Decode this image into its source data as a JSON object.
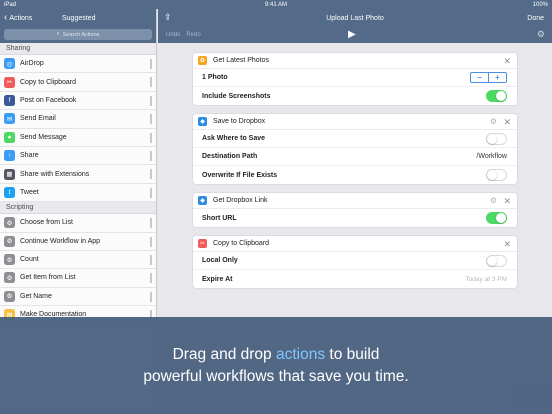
{
  "status": {
    "device": "iPad",
    "time": "9:41 AM",
    "battery": "100%"
  },
  "sidebar": {
    "back_label": "Actions",
    "title": "Suggested",
    "search_placeholder": "Search Actions",
    "sections": [
      {
        "header": "Sharing",
        "items": [
          {
            "label": "AirDrop",
            "color": "#3b9df5",
            "icon": "airdrop-icon",
            "glyph": "◎"
          },
          {
            "label": "Copy to Clipboard",
            "color": "#f05a5a",
            "icon": "scissors-icon",
            "glyph": "✂"
          },
          {
            "label": "Post on Facebook",
            "color": "#3b5998",
            "icon": "facebook-icon",
            "glyph": "f"
          },
          {
            "label": "Send Email",
            "color": "#3b9df5",
            "icon": "mail-icon",
            "glyph": "✉"
          },
          {
            "label": "Send Message",
            "color": "#4cd964",
            "icon": "message-icon",
            "glyph": "●"
          },
          {
            "label": "Share",
            "color": "#3b9df5",
            "icon": "share-icon",
            "glyph": "↑"
          },
          {
            "label": "Share with Extensions",
            "color": "#556",
            "icon": "extensions-icon",
            "glyph": "▦"
          },
          {
            "label": "Tweet",
            "color": "#1da1f2",
            "icon": "twitter-icon",
            "glyph": "t"
          }
        ]
      },
      {
        "header": "Scripting",
        "items": [
          {
            "label": "Choose from List",
            "color": "#8e8e93",
            "icon": "gear-icon",
            "glyph": "⚙"
          },
          {
            "label": "Continue Workflow in App",
            "color": "#8e8e93",
            "icon": "gear-icon",
            "glyph": "⚙"
          },
          {
            "label": "Count",
            "color": "#8e8e93",
            "icon": "gear-icon",
            "glyph": "⚙"
          },
          {
            "label": "Get Item from List",
            "color": "#8e8e93",
            "icon": "gear-icon",
            "glyph": "⚙"
          },
          {
            "label": "Get Name",
            "color": "#8e8e93",
            "icon": "gear-icon",
            "glyph": "⚙"
          },
          {
            "label": "Make Documentation",
            "color": "#f5c242",
            "icon": "documentation-icon",
            "glyph": "▤"
          }
        ]
      }
    ]
  },
  "main": {
    "title": "Upload Last Photo",
    "done_label": "Done",
    "undo_label": "Undo",
    "redo_label": "Redo",
    "actions": [
      {
        "title": "Get Latest Photos",
        "color": "#f5a623",
        "icon": "photos-icon",
        "glyph": "✿",
        "settings": false,
        "rows": [
          {
            "label": "1 Photo",
            "control": "stepper"
          },
          {
            "label": "Include Screenshots",
            "control": "toggle",
            "on": true
          }
        ]
      },
      {
        "title": "Save to Dropbox",
        "color": "#2d8be8",
        "icon": "dropbox-icon",
        "glyph": "◆",
        "settings": true,
        "rows": [
          {
            "label": "Ask Where to Save",
            "control": "toggle",
            "on": false
          },
          {
            "label": "Destination Path",
            "control": "value",
            "value": "/Workflow"
          },
          {
            "label": "Overwrite If File Exists",
            "control": "toggle",
            "on": false
          }
        ]
      },
      {
        "title": "Get Dropbox Link",
        "color": "#2d8be8",
        "icon": "dropbox-icon",
        "glyph": "◆",
        "settings": true,
        "rows": [
          {
            "label": "Short URL",
            "control": "toggle",
            "on": true
          }
        ]
      },
      {
        "title": "Copy to Clipboard",
        "color": "#f05a5a",
        "icon": "scissors-icon",
        "glyph": "✂",
        "settings": false,
        "rows": [
          {
            "label": "Local Only",
            "control": "toggle",
            "on": false
          },
          {
            "label": "Expire At",
            "control": "placeholder",
            "value": "Today at 3 PM"
          }
        ]
      }
    ]
  },
  "overlay": {
    "line1_before": "Drag and drop ",
    "line1_highlight": "actions",
    "line1_after": " to build",
    "line2": "powerful workflows that save you time."
  }
}
